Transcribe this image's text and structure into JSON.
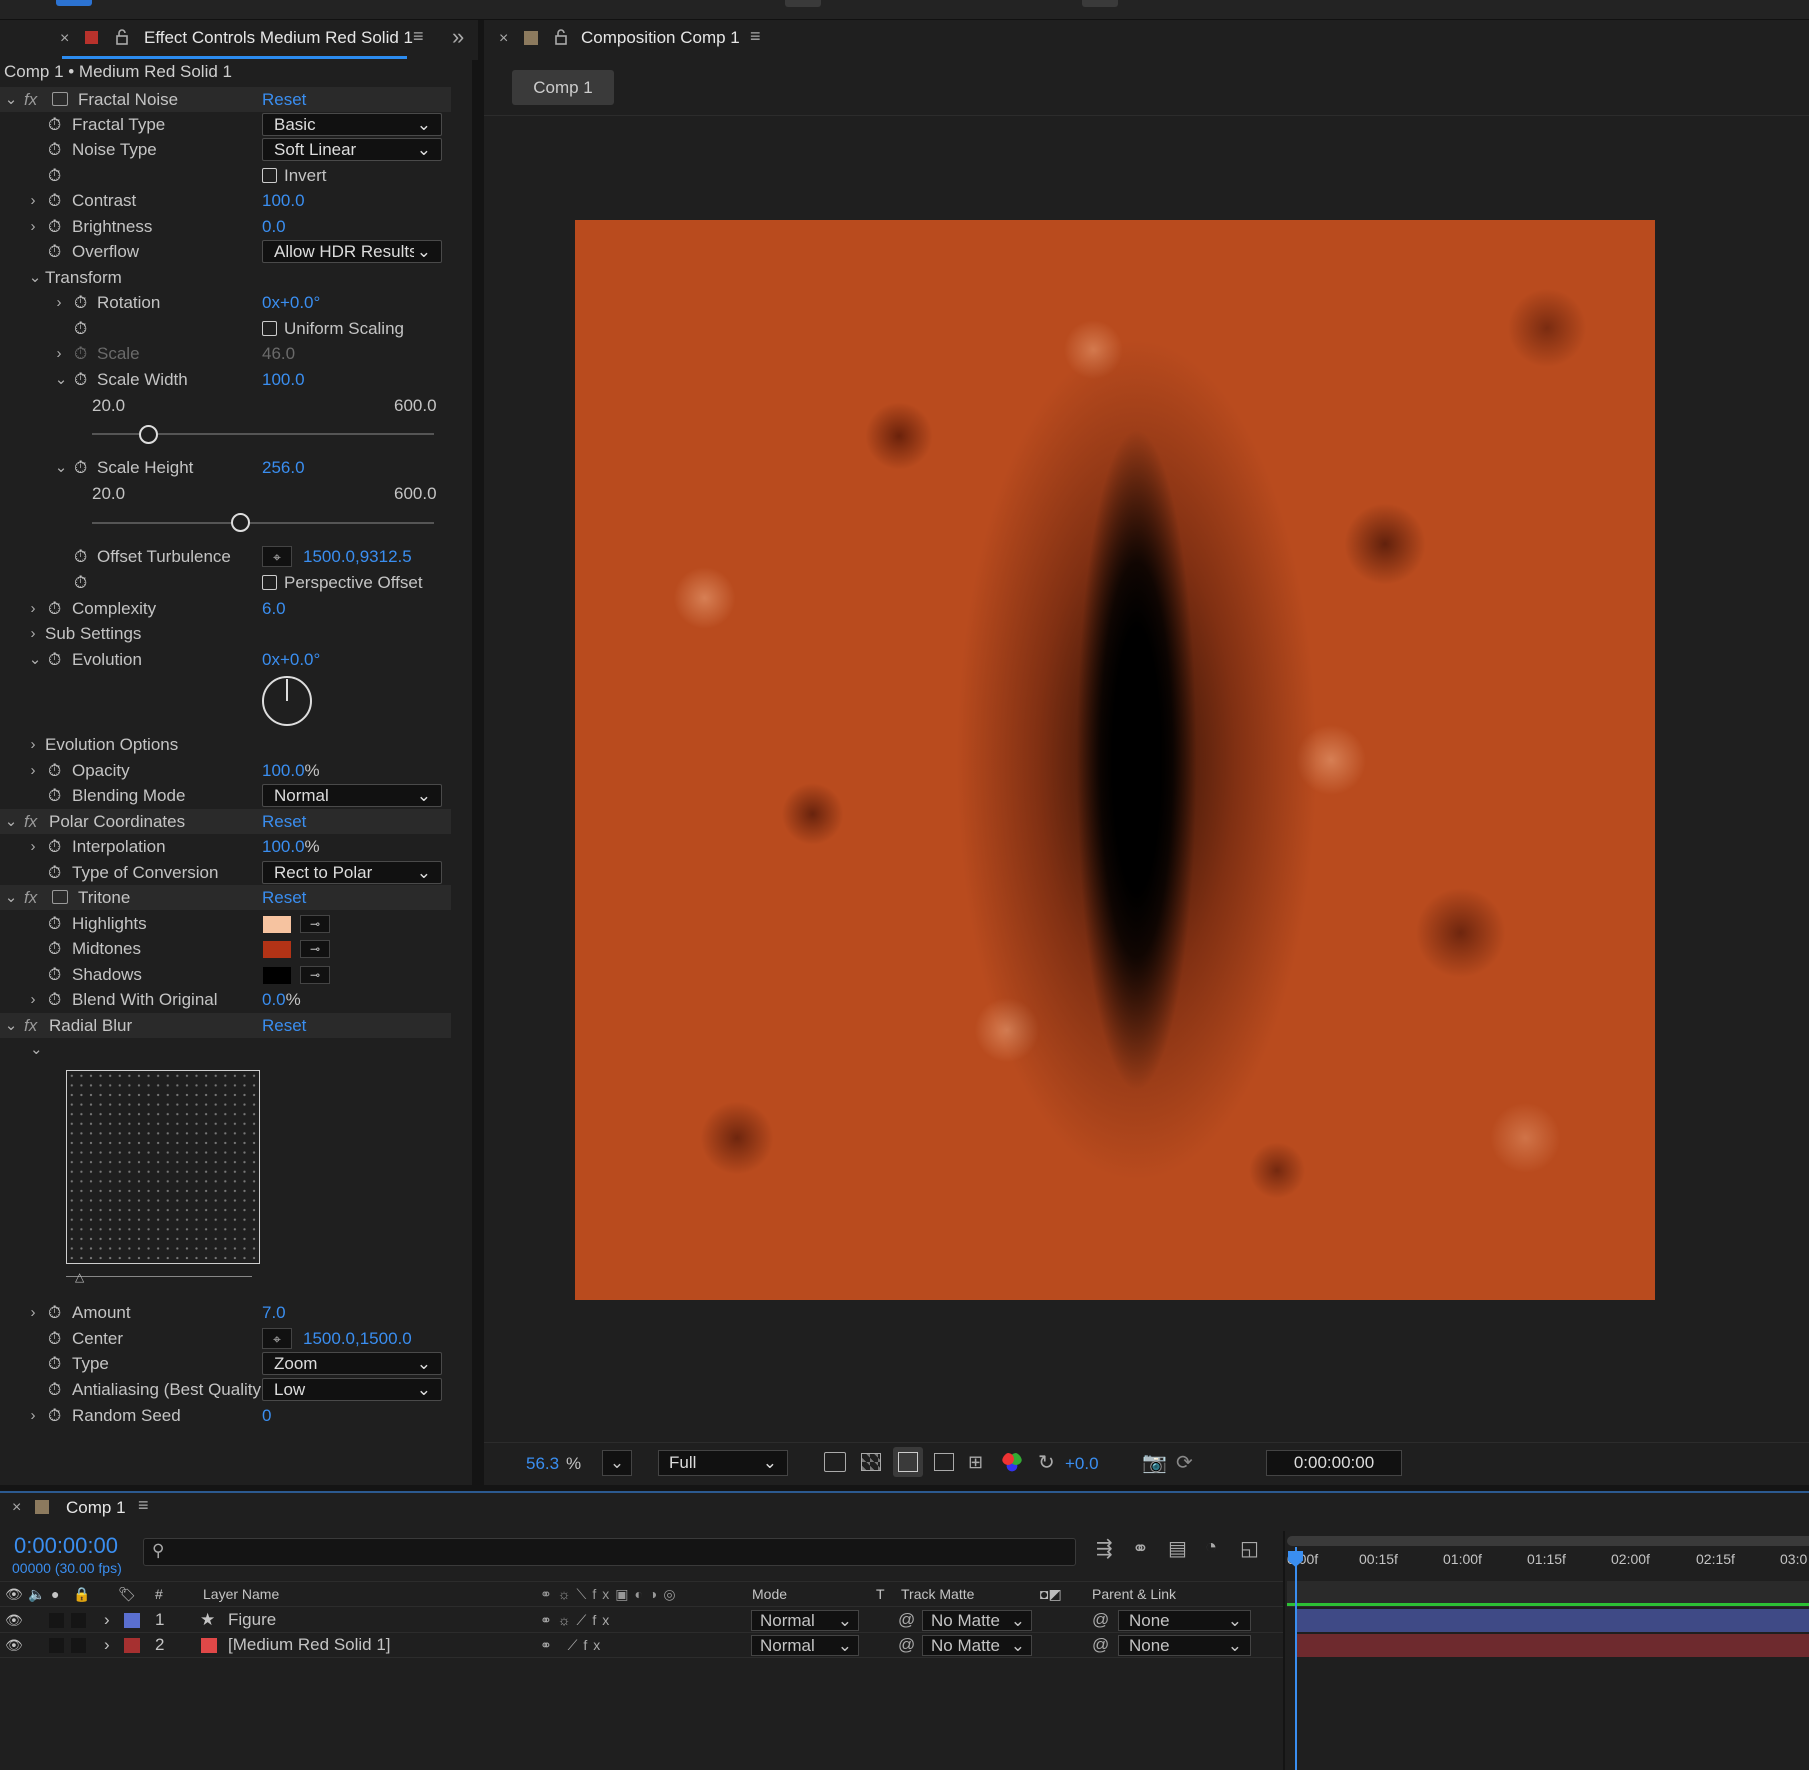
{
  "effect_panel": {
    "tab_title": "Effect Controls Medium Red Solid 1",
    "breadcrumb": "Comp 1 • Medium Red Solid 1",
    "fractal_noise": {
      "name": "Fractal Noise",
      "reset": "Reset",
      "fractal_type_label": "Fractal Type",
      "fractal_type_value": "Basic",
      "noise_type_label": "Noise Type",
      "noise_type_value": "Soft Linear",
      "invert_label": "Invert",
      "contrast_label": "Contrast",
      "contrast_value": "100.0",
      "brightness_label": "Brightness",
      "brightness_value": "0.0",
      "overflow_label": "Overflow",
      "overflow_value": "Allow HDR Results",
      "transform_label": "Transform",
      "rotation_label": "Rotation",
      "rotation_value": "0x+0.0°",
      "uniform_scaling_label": "Uniform Scaling",
      "scale_label": "Scale",
      "scale_value": "46.0",
      "scale_width_label": "Scale Width",
      "scale_width_value": "100.0",
      "scale_width_min": "20.0",
      "scale_width_max": "600.0",
      "scale_height_label": "Scale Height",
      "scale_height_value": "256.0",
      "scale_height_min": "20.0",
      "scale_height_max": "600.0",
      "offset_turbulence_label": "Offset Turbulence",
      "offset_turbulence_value": "1500.0,9312.5",
      "perspective_offset_label": "Perspective Offset",
      "complexity_label": "Complexity",
      "complexity_value": "6.0",
      "sub_settings_label": "Sub Settings",
      "evolution_label": "Evolution",
      "evolution_value": "0x+0.0°",
      "evolution_options_label": "Evolution Options",
      "opacity_label": "Opacity",
      "opacity_value": "100.0",
      "opacity_unit": "%",
      "blending_mode_label": "Blending Mode",
      "blending_mode_value": "Normal"
    },
    "polar_coordinates": {
      "name": "Polar Coordinates",
      "reset": "Reset",
      "interpolation_label": "Interpolation",
      "interpolation_value": "100.0",
      "interpolation_unit": "%",
      "type_of_conversion_label": "Type of Conversion",
      "type_of_conversion_value": "Rect to Polar"
    },
    "tritone": {
      "name": "Tritone",
      "reset": "Reset",
      "highlights_label": "Highlights",
      "highlights_color": "#f6c3a0",
      "midtones_label": "Midtones",
      "midtones_color": "#b23316",
      "shadows_label": "Shadows",
      "shadows_color": "#000000",
      "blend_label": "Blend With Original",
      "blend_value": "0.0",
      "blend_unit": "%"
    },
    "radial_blur": {
      "name": "Radial Blur",
      "reset": "Reset",
      "amount_label": "Amount",
      "amount_value": "7.0",
      "center_label": "Center",
      "center_value": "1500.0,1500.0",
      "type_label": "Type",
      "type_value": "Zoom",
      "antialiasing_label": "Antialiasing (Best Quality",
      "antialiasing_value": "Low",
      "random_seed_label": "Random Seed",
      "random_seed_value": "0"
    }
  },
  "comp_panel": {
    "tab_title": "Composition Comp 1",
    "comp_tab": "Comp 1",
    "zoom_value": "56.3",
    "zoom_unit": "%",
    "resolution": "Full",
    "exposure": "+0.0",
    "timecode": "0:00:00:00"
  },
  "timeline": {
    "tab_title": "Comp 1",
    "current_time": "0:00:00:00",
    "frame_info": "00000 (30.00 fps)",
    "columns": {
      "num": "#",
      "layer_name": "Layer Name",
      "mode": "Mode",
      "t": "T",
      "track_matte": "Track Matte",
      "parent": "Parent & Link"
    },
    "ruler": [
      "0:00f",
      "00:15f",
      "01:00f",
      "01:15f",
      "02:00f",
      "02:15f",
      "03:0"
    ],
    "layers": [
      {
        "num": "1",
        "name": "Figure",
        "mode": "Normal",
        "matte": "No Matte",
        "parent": "None",
        "label_color": "#5a6fd0",
        "bar_color": "#3f4a86"
      },
      {
        "num": "2",
        "name": "[Medium Red Solid 1]",
        "mode": "Normal",
        "matte": "No Matte",
        "parent": "None",
        "label_color": "#e04848",
        "bar_color": "#6e2a2e"
      }
    ]
  }
}
